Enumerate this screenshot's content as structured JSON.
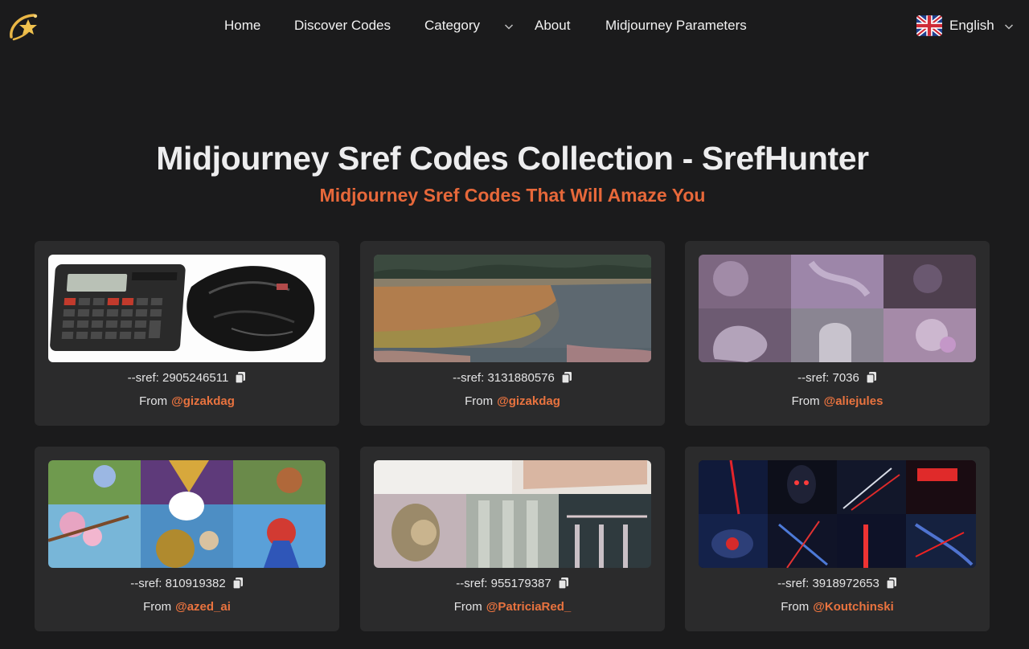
{
  "nav": {
    "items": [
      {
        "label": "Home"
      },
      {
        "label": "Discover Codes"
      },
      {
        "label": "Category"
      },
      {
        "label": "About"
      },
      {
        "label": "Midjourney Parameters"
      }
    ],
    "language": "English"
  },
  "hero": {
    "title": "Midjourney Sref Codes Collection - SrefHunter",
    "subtitle": "Midjourney Sref Codes That Will Amaze You"
  },
  "cards": [
    {
      "sref": "--sref: 2905246511",
      "from_label": "From",
      "author": "@gizakdag"
    },
    {
      "sref": "--sref: 3131880576",
      "from_label": "From",
      "author": "@gizakdag"
    },
    {
      "sref": "--sref: 7036",
      "from_label": "From",
      "author": "@aliejules"
    },
    {
      "sref": "--sref: 810919382",
      "from_label": "From",
      "author": "@azed_ai"
    },
    {
      "sref": "--sref: 955179387",
      "from_label": "From",
      "author": "@PatriciaRed_"
    },
    {
      "sref": "--sref: 3918972653",
      "from_label": "From",
      "author": "@Koutchinski"
    }
  ],
  "colors": {
    "background": "#1b1b1c",
    "card": "#2b2b2c",
    "accent": "#e7683a"
  },
  "icons": {
    "logo": "shooting-star-logo-icon",
    "dropdown": "chevron-down-icon",
    "flag": "uk-flag-icon",
    "copy": "copy-icon"
  }
}
